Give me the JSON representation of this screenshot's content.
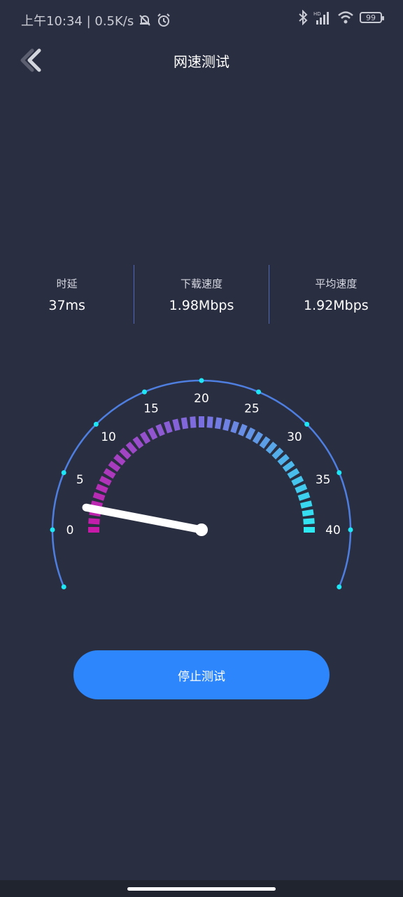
{
  "status_bar": {
    "time_and_speed": "上午10:34 | 0.5K/s",
    "battery": "99"
  },
  "header": {
    "title": "网速测试"
  },
  "stats": [
    {
      "label": "时延",
      "value": "37ms"
    },
    {
      "label": "下载速度",
      "value": "1.98Mbps"
    },
    {
      "label": "平均速度",
      "value": "1.92Mbps"
    }
  ],
  "gauge": {
    "min": 0,
    "max": 40,
    "ticks": [
      "0",
      "5",
      "10",
      "15",
      "20",
      "25",
      "30",
      "35",
      "40"
    ],
    "current_value": 1.98,
    "colors": {
      "arc": "#4e7fe0",
      "dot": "#1ee6f5",
      "gradient_start": "#c71aa8",
      "gradient_mid": "#7a6fe0",
      "gradient_end": "#2ee8f2"
    }
  },
  "actions": {
    "stop_label": "停止测试"
  }
}
